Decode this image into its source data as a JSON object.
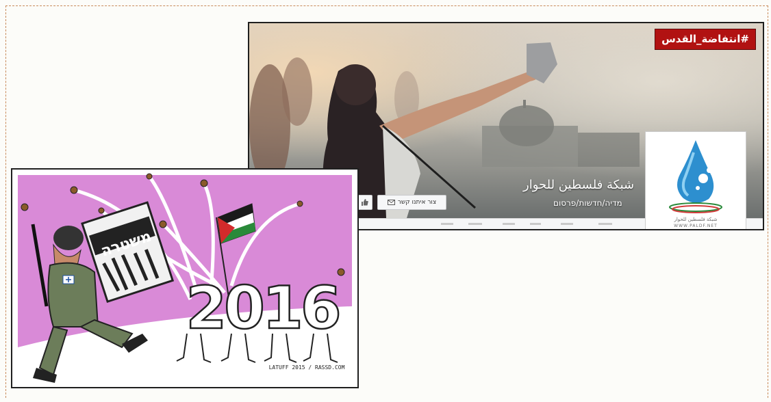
{
  "facebook_page": {
    "hashtag": "#انتفاضة_القدس",
    "page_name": "شبكة فلسطين للحوار",
    "page_category": "מדיה/חדשות/פרסום",
    "contact_button": "צור איתנו קשר",
    "logo_name": "شبكة فلسطين للحوار",
    "logo_url": "WWW.PALDF.NET"
  },
  "cartoon": {
    "shield_text": "משטרה",
    "year": "2016",
    "signature": "LATUFF 2015 / RASSD.COM"
  },
  "colors": {
    "frame_border": "#c88a5a",
    "hashtag_bg": "#b11212",
    "cartoon_bg": "#d98ad7",
    "logo_blue": "#2d8fcf"
  }
}
